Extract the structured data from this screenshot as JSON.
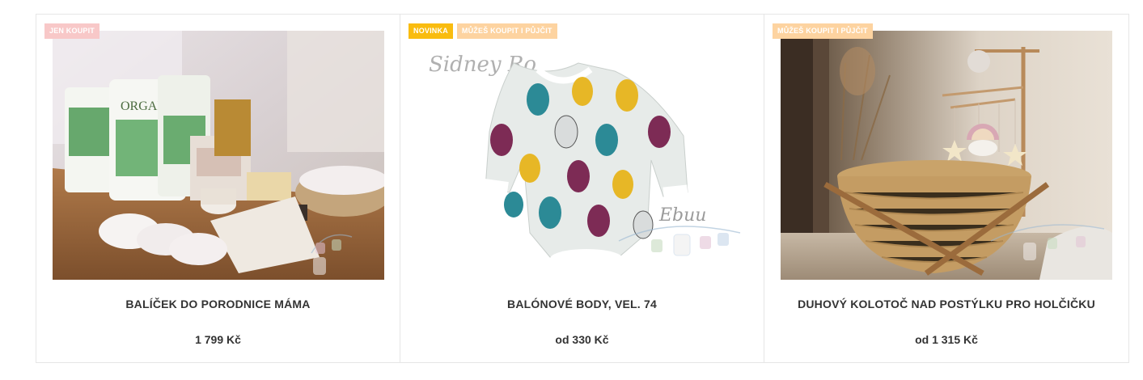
{
  "products": [
    {
      "name": "BALÍČEK DO PORODNICE MÁMA",
      "price": "1 799 Kč",
      "flags": [
        {
          "label": "JEN KOUPIT",
          "color": "#f8c8c8"
        }
      ],
      "image": "maternity-bundle-photo"
    },
    {
      "name": "BALÓNOVÉ BODY, VEL. 74",
      "price": "od 330 Kč",
      "flags": [
        {
          "label": "NOVINKA",
          "color": "#f9bc0f"
        },
        {
          "label": "MŮŽEŠ KOUPIT I PŮJČIT",
          "color": "#fdd3a0"
        }
      ],
      "image": "balloon-bodysuit-photo",
      "watermark_top": "Sidney Ro",
      "watermark_bottom": "Ebuu"
    },
    {
      "name": "DUHOVÝ KOLOTOČ NAD POSTÝLKU PRO HOLČIČKU",
      "price": "od 1 315 Kč",
      "flags": [
        {
          "label": "MŮŽEŠ KOUPIT I PŮJČIT",
          "color": "#fdd3a0"
        }
      ],
      "image": "rainbow-mobile-crib-photo"
    }
  ]
}
